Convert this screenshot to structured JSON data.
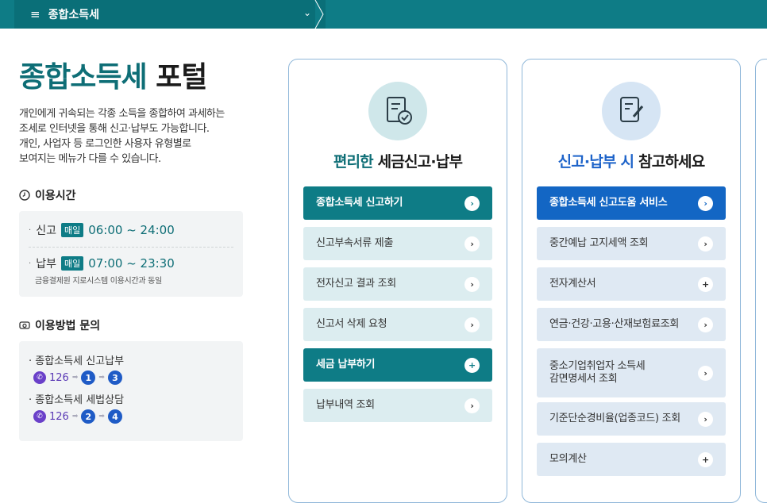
{
  "topbar": {
    "menu_title": "종합소득세",
    "hamburger": "≡",
    "chevron": "⌄"
  },
  "hero": {
    "title_accent": "종합소득세",
    "title_rest": " 포털",
    "desc_lines": [
      "개인에게 귀속되는 각종 소득을 종합하여 과세하는",
      "조세로 인터넷을 통해 신고·납부도 가능합니다.",
      "개인, 사업자 등 로그인한 사용자 유형별로",
      "보여지는 메뉴가 다를 수 있습니다."
    ]
  },
  "hours": {
    "heading": "이용시간",
    "rows": [
      {
        "label": "신고",
        "badge": "매일",
        "time": "06:00 ~ 24:00"
      },
      {
        "label": "납부",
        "badge": "매일",
        "time": "07:00 ~ 23:30"
      }
    ],
    "note": "금융결제원 지로시스템 이용시간과 동일"
  },
  "inquiry": {
    "heading": "이용방법 문의",
    "items": [
      {
        "label": "종합소득세 신고납부",
        "phone": "126",
        "steps": [
          "1",
          "3"
        ]
      },
      {
        "label": "종합소득세 세법상담",
        "phone": "126",
        "steps": [
          "2",
          "4"
        ]
      }
    ]
  },
  "card1": {
    "title_accent": "편리한",
    "title_rest": " 세금신고·납부",
    "emblem_icon": "receipt-check-icon",
    "buttons": [
      {
        "label": "종합소득세 신고하기",
        "primary": true,
        "icon": "›"
      },
      {
        "label": "신고부속서류 제출",
        "primary": false,
        "icon": "›"
      },
      {
        "label": "전자신고 결과 조회",
        "primary": false,
        "icon": "›"
      },
      {
        "label": "신고서 삭제 요청",
        "primary": false,
        "icon": "›"
      },
      {
        "label": "세금 납부하기",
        "primary": true,
        "icon": "+"
      },
      {
        "label": "납부내역 조회",
        "primary": false,
        "icon": "›"
      }
    ]
  },
  "card2": {
    "title_accent": "신고·납부 시",
    "title_rest": " 참고하세요",
    "emblem_icon": "document-edit-icon",
    "buttons": [
      {
        "label": "종합소득세 신고도움 서비스",
        "primary": true,
        "icon": "›"
      },
      {
        "label": "중간예납 고지세액 조회",
        "primary": false,
        "icon": "›"
      },
      {
        "label": "전자계산서",
        "primary": false,
        "icon": "+"
      },
      {
        "label": "연금·건강·고용·산재보험료조회",
        "primary": false,
        "icon": "›"
      },
      {
        "label": "중소기업취업자 소득세\n감면명세서 조회",
        "primary": false,
        "icon": "›"
      },
      {
        "label": "기준단순경비율(업종코드) 조회",
        "primary": false,
        "icon": "›"
      },
      {
        "label": "모의계산",
        "primary": false,
        "icon": "+"
      }
    ]
  },
  "colors": {
    "teal": "#0e7c86",
    "blue": "#1366c4",
    "purple": "#6a40c9"
  }
}
